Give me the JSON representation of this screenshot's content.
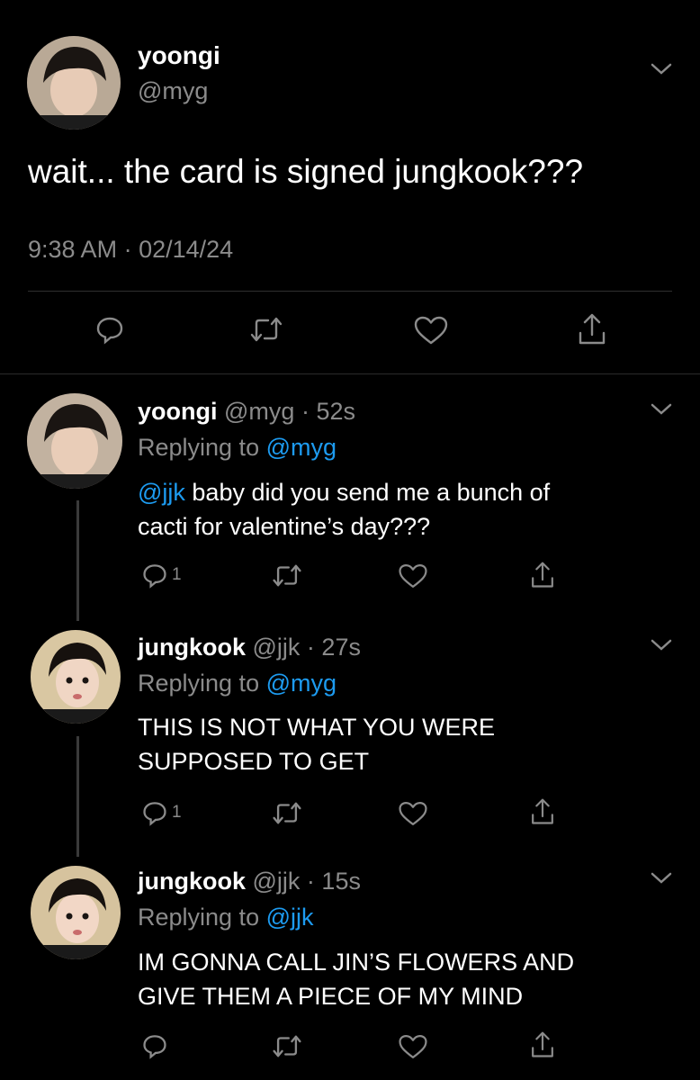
{
  "main_tweet": {
    "name": "yoongi",
    "handle": "@myg",
    "text": "wait... the card is signed jungkook???",
    "time": "9:38 AM",
    "date": "02/14/24"
  },
  "replies": [
    {
      "name": "yoongi",
      "handle": "@myg",
      "age": "52s",
      "replying_prefix": "Replying to",
      "replying_to": "@myg",
      "mention": "@jjk",
      "text_rest": " baby did you send me a bunch of",
      "text_line2": "cacti for valentine’s day???",
      "reply_count": "1"
    },
    {
      "name": "jungkook",
      "handle": "@jjk",
      "age": "27s",
      "replying_prefix": "Replying to",
      "replying_to": "@myg",
      "text_line1": "THIS IS NOT WHAT YOU WERE",
      "text_line2": "SUPPOSED TO GET",
      "reply_count": "1"
    },
    {
      "name": "jungkook",
      "handle": "@jjk",
      "age": "15s",
      "replying_prefix": "Replying to",
      "replying_to": "@jjk",
      "text_line1": "IM GONNA CALL JIN’S FLOWERS AND",
      "text_line2": "GIVE THEM A PIECE OF MY MIND",
      "reply_count": ""
    }
  ],
  "separator": " · ",
  "colors": {
    "background": "#000000",
    "muted": "#8b8b8b",
    "link": "#1d9bf0"
  }
}
